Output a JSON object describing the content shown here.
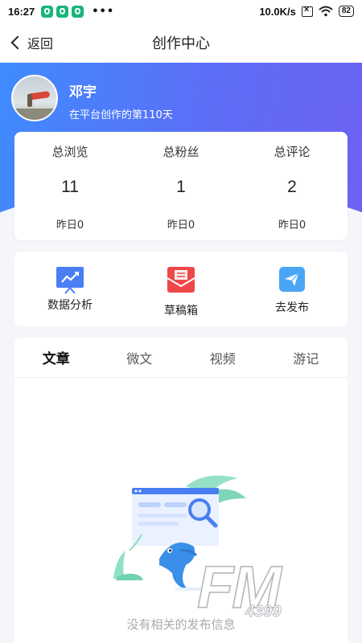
{
  "status_bar": {
    "time": "16:27",
    "network_speed": "10.0K/s",
    "battery": "82",
    "icons": [
      "shield-icon",
      "shield-icon",
      "shield-icon",
      "more-dots-icon",
      "sim-icon",
      "wifi-icon",
      "battery-icon"
    ]
  },
  "nav": {
    "back_label": "返回",
    "title": "创作中心"
  },
  "profile": {
    "name": "邓宇",
    "subtitle": "在平台创作的第110天"
  },
  "stats": [
    {
      "label": "总浏览",
      "value": "11",
      "yesterday": "昨日0"
    },
    {
      "label": "总粉丝",
      "value": "1",
      "yesterday": "昨日0"
    },
    {
      "label": "总评论",
      "value": "2",
      "yesterday": "昨日0"
    }
  ],
  "tools": [
    {
      "label": "数据分析",
      "icon": "data-analysis-icon",
      "color": "#4a7ef3"
    },
    {
      "label": "草稿箱",
      "icon": "draft-box-icon",
      "color": "#ee4848"
    },
    {
      "label": "去发布",
      "icon": "publish-icon",
      "color": "#4aa6f5"
    }
  ],
  "tabs": [
    {
      "label": "文章",
      "active": true
    },
    {
      "label": "微文",
      "active": false
    },
    {
      "label": "视频",
      "active": false
    },
    {
      "label": "游记",
      "active": false
    }
  ],
  "empty_state": {
    "text": "没有相关的发布信息",
    "icon": "dolphin-empty-illustration"
  },
  "watermark": {
    "text": "FM",
    "sub": "4399"
  },
  "colors": {
    "hero_start": "#3f8bff",
    "hero_end": "#6d63f2",
    "background": "#f5f6fa"
  }
}
